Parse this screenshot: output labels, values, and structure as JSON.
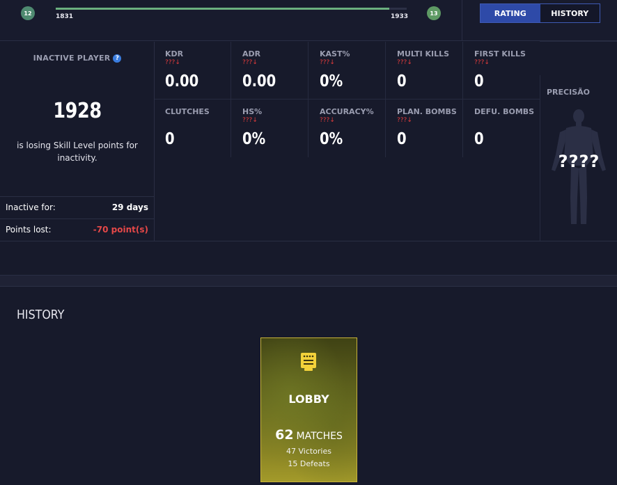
{
  "level_progress": {
    "current_level": "12",
    "next_level": "13",
    "elo_min": "1831",
    "elo_max": "1933",
    "progress_fraction": 0.95
  },
  "tabs": [
    {
      "label": "RATING",
      "active": true
    },
    {
      "label": "HISTORY",
      "active": false
    }
  ],
  "inactive_panel": {
    "title": "INACTIVE PLAYER",
    "help_icon": "?",
    "elo": "1928",
    "message": "is losing Skill Level points for inactivity.",
    "rows": [
      {
        "label": "Inactive for:",
        "value": "29 days"
      },
      {
        "label": "Points lost:",
        "value": "-70 point(s)"
      }
    ]
  },
  "stats": [
    {
      "label": "KDR",
      "trend": "???↓",
      "value": "0.00"
    },
    {
      "label": "ADR",
      "trend": "???↓",
      "value": "0.00"
    },
    {
      "label": "KAST%",
      "trend": "???↓",
      "value": "0%"
    },
    {
      "label": "MULTI KILLS",
      "trend": "???↓",
      "value": "0"
    },
    {
      "label": "FIRST KILLS",
      "trend": "???↓",
      "value": "0"
    },
    {
      "label": "CLUTCHES",
      "trend": "",
      "value": "0"
    },
    {
      "label": "HS%",
      "trend": "???↓",
      "value": "0%"
    },
    {
      "label": "ACCURACY%",
      "trend": "???↓",
      "value": "0%"
    },
    {
      "label": "PLAN. BOMBS",
      "trend": "???↓",
      "value": "0"
    },
    {
      "label": "DEFU. BOMBS",
      "trend": "",
      "value": "0"
    }
  ],
  "precision": {
    "label": "PRECISÃO",
    "value": "????"
  },
  "history": {
    "title": "HISTORY",
    "cards": [
      {
        "title": "LOBBY",
        "matches_count": "62",
        "matches_label": "MATCHES",
        "victories": "47 Victories",
        "defeats": "15 Defeats"
      }
    ]
  },
  "colors": {
    "background": "#171a2b",
    "accent_blue": "#2e4aa8",
    "progress_green": "#6bb07f",
    "loss_red": "#e54848",
    "card_border": "#c8b33a"
  }
}
